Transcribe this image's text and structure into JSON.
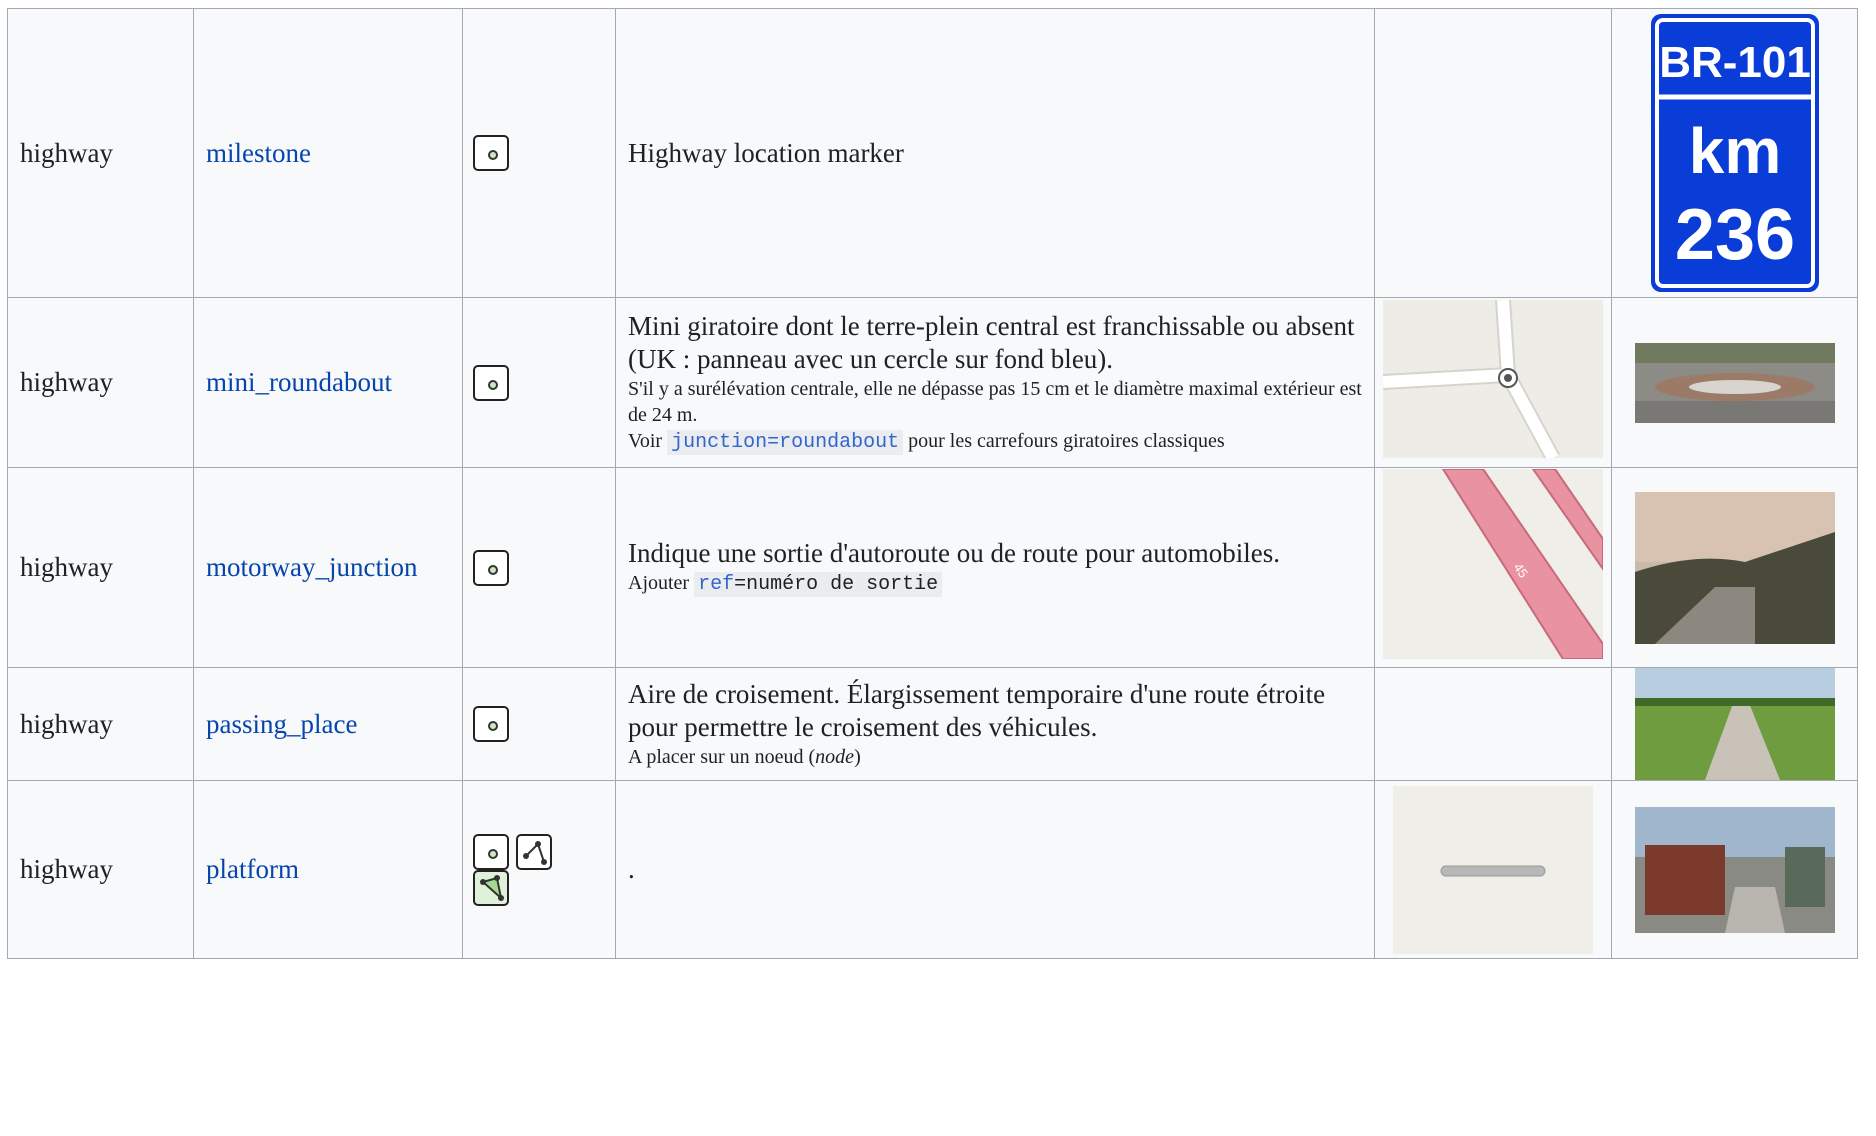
{
  "rows": [
    {
      "key": "highway",
      "value": "milestone",
      "elements": [
        "node"
      ],
      "description": "Highway location marker",
      "sign": {
        "top": "BR-101",
        "mid": "km",
        "bottom": "236"
      }
    },
    {
      "key": "highway",
      "value": "mini_roundabout",
      "elements": [
        "node"
      ],
      "description_main": "Mini giratoire dont le terre-plein central est franchissable ou absent (UK : panneau avec un cercle sur fond bleu).",
      "description_small1": "S'il y a surélévation centrale, elle ne dépasse pas 15 cm et le diamètre maximal extérieur est de 24 m.",
      "description_small2_pre": "Voir",
      "description_code": "junction=roundabout",
      "description_small2_post": "pour les carrefours giratoires classiques"
    },
    {
      "key": "highway",
      "value": "motorway_junction",
      "elements": [
        "node"
      ],
      "description_main": "Indique une sortie d'autoroute ou de route pour automobiles.",
      "description_small_pre": "Ajouter",
      "description_code_key": "ref",
      "description_code_rest": "=numéro de sortie",
      "map_label": "45"
    },
    {
      "key": "highway",
      "value": "passing_place",
      "elements": [
        "node"
      ],
      "description_main": "Aire de croisement. Élargissement temporaire d'une route étroite pour permettre le croisement des véhicules.",
      "description_small_pre": "A placer sur un noeud (",
      "description_small_em": "node",
      "description_small_post": ")"
    },
    {
      "key": "highway",
      "value": "platform",
      "elements": [
        "node",
        "way",
        "area"
      ],
      "description": "."
    }
  ],
  "icons": {
    "node": "node-icon",
    "way": "way-icon",
    "area": "area-icon"
  },
  "colors": {
    "link": "#0645ad",
    "border": "#a2a9b1",
    "cell_bg": "#f8f9fa",
    "sign_blue": "#0a3cd8",
    "motorway_pink": "#e892a2"
  }
}
